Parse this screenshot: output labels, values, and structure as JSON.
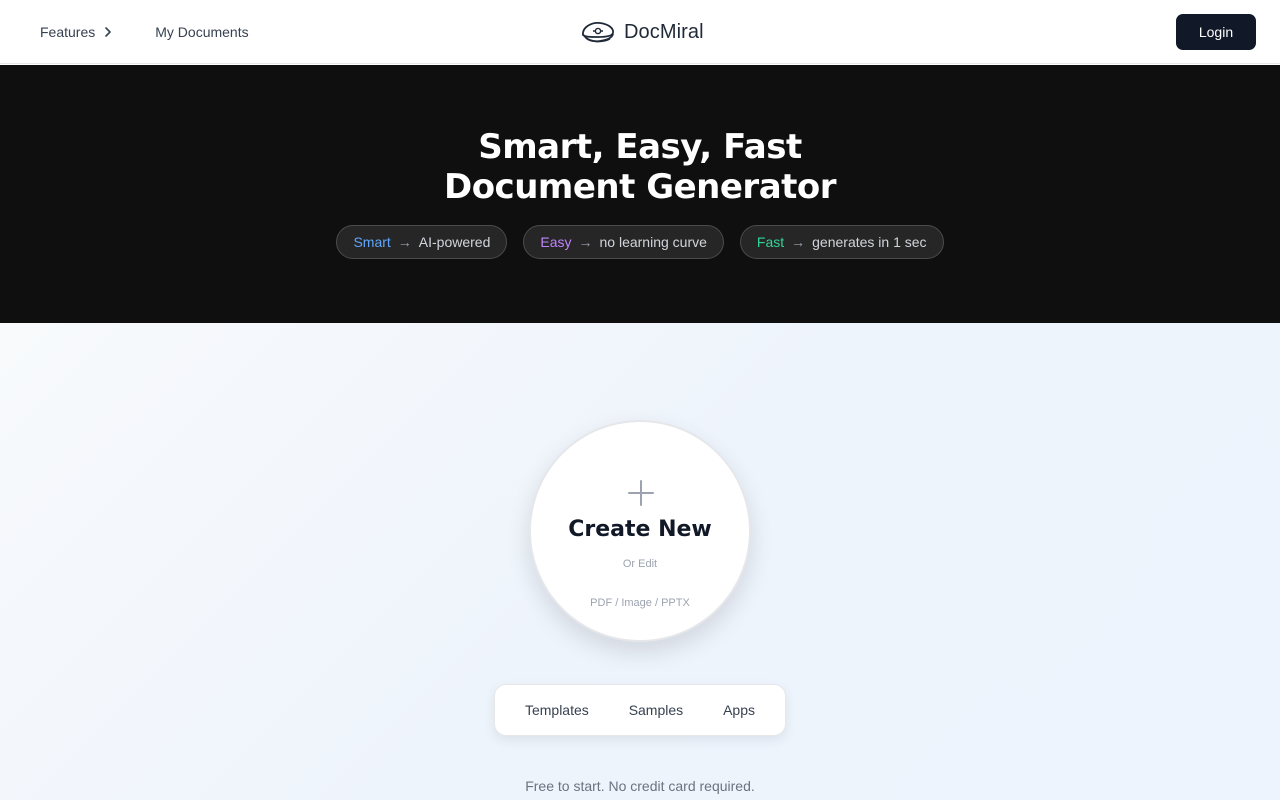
{
  "header": {
    "nav": {
      "features_label": "Features",
      "documents_label": "My Documents"
    },
    "brand_name": "DocMiral",
    "login_label": "Login"
  },
  "hero": {
    "title_line1": "Smart, Easy, Fast",
    "title_line2": "Document Generator",
    "pills": [
      {
        "keyword": "Smart",
        "arrow": "→",
        "text": "AI-powered",
        "color": "#60a5fa"
      },
      {
        "keyword": "Easy",
        "arrow": "→",
        "text": "no learning curve",
        "color": "#c084fc"
      },
      {
        "keyword": "Fast",
        "arrow": "→",
        "text": "generates in 1 sec",
        "color": "#34d399"
      }
    ]
  },
  "create": {
    "icon": "plus-icon",
    "title": "Create New",
    "subtitle": "Or Edit",
    "formats": "PDF / Image / PPTX"
  },
  "tabs": [
    {
      "label": "Templates"
    },
    {
      "label": "Samples"
    },
    {
      "label": "Apps"
    }
  ],
  "footer_note": "Free to start. No credit card required.",
  "colors": {
    "hero_bg": "#0f0f0f",
    "login_bg": "#111827",
    "smart": "#60a5fa",
    "easy": "#c084fc",
    "fast": "#34d399"
  }
}
